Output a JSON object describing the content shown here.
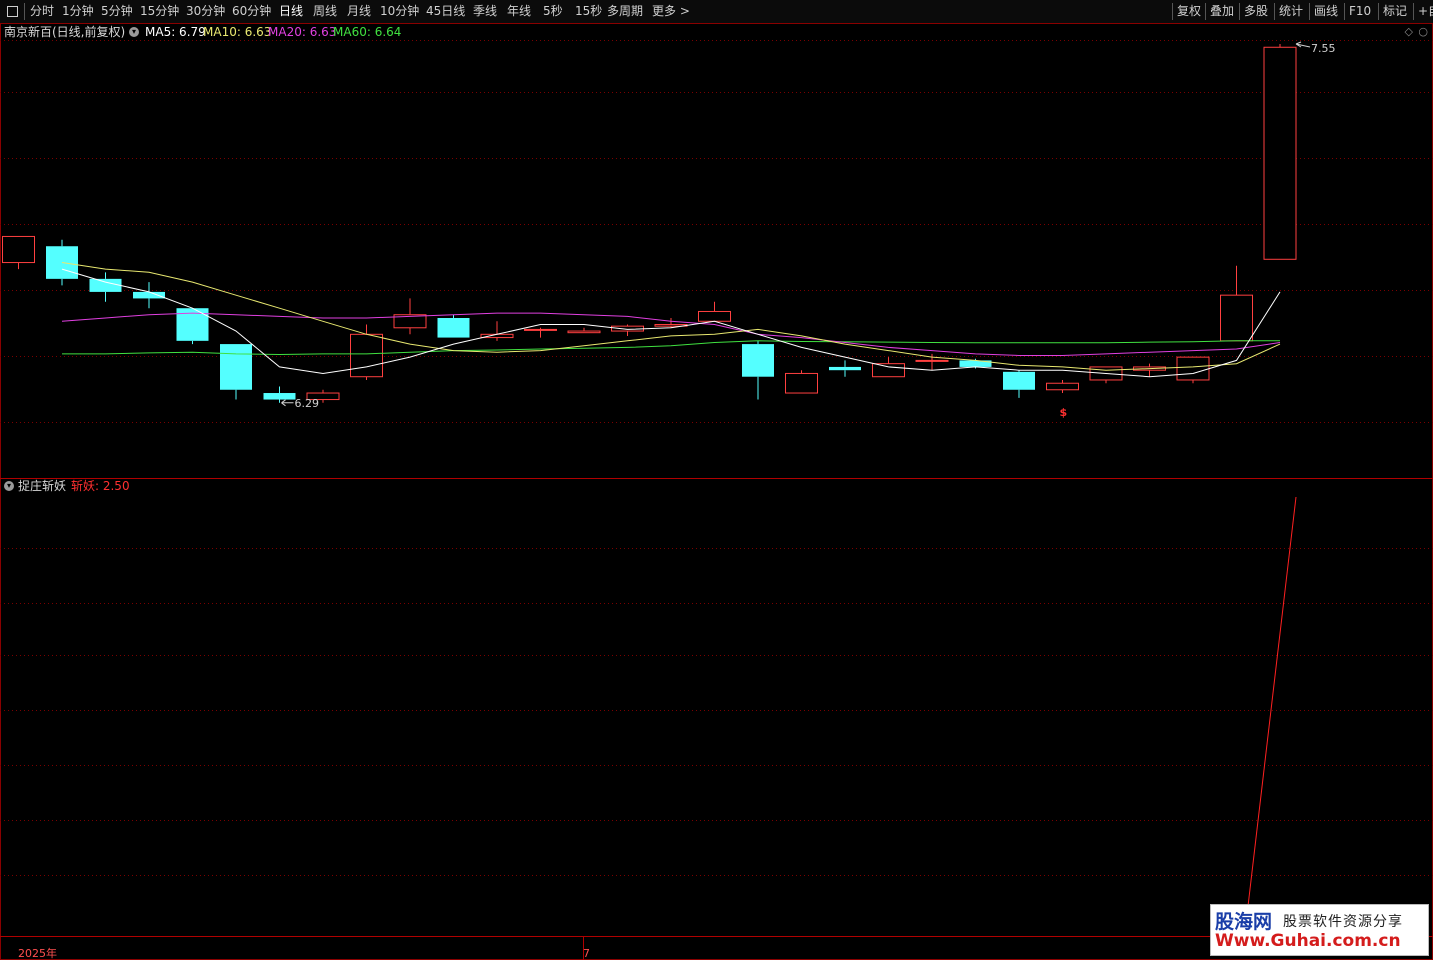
{
  "toolbar": {
    "periods": [
      "分时",
      "1分钟",
      "5分钟",
      "15分钟",
      "30分钟",
      "60分钟",
      "日线",
      "周线",
      "月线",
      "10分钟",
      "45日线",
      "季线",
      "年线",
      "5秒",
      "15秒",
      "多周期",
      "更多 >"
    ],
    "active_period": "日线",
    "right_buttons": [
      "复权",
      "叠加",
      "多股",
      "统计",
      "画线",
      "F10",
      "标记",
      "+自"
    ]
  },
  "main_chart": {
    "title": "南京新百(日线,前复权)",
    "ma": [
      {
        "label": "MA5: 6.79",
        "color": "#ffffff"
      },
      {
        "label": "MA10: 6.63",
        "color": "#e8e870"
      },
      {
        "label": "MA20: 6.63",
        "color": "#e040e0"
      },
      {
        "label": "MA60: 6.64",
        "color": "#40e040"
      }
    ],
    "high_label": "7.55",
    "low_label": "6.29",
    "signal_mark": "$"
  },
  "sub_chart": {
    "title": "捉庄斩妖",
    "value_label": "斩妖: 2.50"
  },
  "time_axis": {
    "year_label": "2025年",
    "month_label": "7"
  },
  "watermark": {
    "name": "股海网",
    "tagline": "股票软件资源分享",
    "url": "Www.Guhai.com.cn"
  },
  "colors": {
    "up": "#ff4040",
    "down": "#54ffff",
    "ma5": "#ffffff",
    "ma10": "#e8e870",
    "ma20": "#e040e0",
    "ma60": "#40e040",
    "grid": "#7a0000",
    "indicator": "#ff2020"
  },
  "chart_data": {
    "type": "candlestick",
    "price_range": [
      6.29,
      7.55
    ],
    "candles": [
      {
        "o": 6.88,
        "c": 6.96,
        "h": 6.96,
        "l": 6.86
      },
      {
        "o": 6.93,
        "c": 6.83,
        "h": 6.95,
        "l": 6.81
      },
      {
        "o": 6.83,
        "c": 6.79,
        "h": 6.85,
        "l": 6.76
      },
      {
        "o": 6.79,
        "c": 6.77,
        "h": 6.82,
        "l": 6.74
      },
      {
        "o": 6.74,
        "c": 6.64,
        "h": 6.74,
        "l": 6.63
      },
      {
        "o": 6.63,
        "c": 6.49,
        "h": 6.63,
        "l": 6.46
      },
      {
        "o": 6.48,
        "c": 6.46,
        "h": 6.5,
        "l": 6.45
      },
      {
        "o": 6.46,
        "c": 6.48,
        "h": 6.49,
        "l": 6.45
      },
      {
        "o": 6.53,
        "c": 6.66,
        "h": 6.69,
        "l": 6.52
      },
      {
        "o": 6.68,
        "c": 6.72,
        "h": 6.77,
        "l": 6.66
      },
      {
        "o": 6.71,
        "c": 6.65,
        "h": 6.72,
        "l": 6.65
      },
      {
        "o": 6.65,
        "c": 6.66,
        "h": 6.7,
        "l": 6.64
      },
      {
        "o": 6.675,
        "c": 6.675,
        "h": 6.68,
        "l": 6.65
      },
      {
        "o": 6.665,
        "c": 6.67,
        "h": 6.68,
        "l": 6.665
      },
      {
        "o": 6.67,
        "c": 6.685,
        "h": 6.69,
        "l": 6.655
      },
      {
        "o": 6.685,
        "c": 6.69,
        "h": 6.71,
        "l": 6.68
      },
      {
        "o": 6.7,
        "c": 6.73,
        "h": 6.76,
        "l": 6.7
      },
      {
        "o": 6.63,
        "c": 6.53,
        "h": 6.64,
        "l": 6.46
      },
      {
        "o": 6.48,
        "c": 6.54,
        "h": 6.55,
        "l": 6.48
      },
      {
        "o": 6.56,
        "c": 6.55,
        "h": 6.58,
        "l": 6.53
      },
      {
        "o": 6.53,
        "c": 6.57,
        "h": 6.59,
        "l": 6.53
      },
      {
        "o": 6.58,
        "c": 6.58,
        "h": 6.6,
        "l": 6.55
      },
      {
        "o": 6.58,
        "c": 6.56,
        "h": 6.585,
        "l": 6.555
      },
      {
        "o": 6.545,
        "c": 6.49,
        "h": 6.55,
        "l": 6.465
      },
      {
        "o": 6.49,
        "c": 6.51,
        "h": 6.52,
        "l": 6.48
      },
      {
        "o": 6.52,
        "c": 6.56,
        "h": 6.56,
        "l": 6.51
      },
      {
        "o": 6.55,
        "c": 6.56,
        "h": 6.57,
        "l": 6.53
      },
      {
        "o": 6.52,
        "c": 6.59,
        "h": 6.59,
        "l": 6.51
      },
      {
        "o": 6.64,
        "c": 6.78,
        "h": 6.87,
        "l": 6.64
      },
      {
        "o": 6.89,
        "c": 7.54,
        "h": 7.55,
        "l": 6.89
      }
    ],
    "ma5": [
      null,
      6.86,
      6.82,
      6.79,
      6.74,
      6.67,
      6.56,
      6.54,
      6.56,
      6.59,
      6.63,
      6.66,
      6.69,
      6.69,
      6.675,
      6.68,
      6.7,
      6.66,
      6.62,
      6.59,
      6.56,
      6.55,
      6.56,
      6.55,
      6.55,
      6.54,
      6.53,
      6.54,
      6.58,
      6.79
    ],
    "ma10": [
      null,
      6.88,
      6.86,
      6.85,
      6.82,
      6.78,
      6.74,
      6.7,
      6.66,
      6.63,
      6.61,
      6.605,
      6.61,
      6.625,
      6.64,
      6.655,
      6.66,
      6.675,
      6.655,
      6.63,
      6.61,
      6.59,
      6.58,
      6.565,
      6.56,
      6.55,
      6.555,
      6.56,
      6.57,
      6.63
    ],
    "ma20": [
      null,
      6.7,
      6.71,
      6.72,
      6.725,
      6.72,
      6.715,
      6.71,
      6.71,
      6.715,
      6.72,
      6.725,
      6.725,
      6.72,
      6.715,
      6.7,
      6.69,
      6.66,
      6.65,
      6.635,
      6.62,
      6.61,
      6.6,
      6.595,
      6.595,
      6.6,
      6.605,
      6.61,
      6.615,
      6.635
    ],
    "ma60": [
      null,
      6.6,
      6.6,
      6.603,
      6.605,
      6.6,
      6.598,
      6.6,
      6.6,
      6.605,
      6.61,
      6.612,
      6.615,
      6.617,
      6.62,
      6.625,
      6.635,
      6.64,
      6.638,
      6.637,
      6.636,
      6.635,
      6.634,
      6.634,
      6.634,
      6.634,
      6.636,
      6.637,
      6.64,
      6.64
    ],
    "indicator": {
      "name": "斩妖",
      "values": [
        0,
        0,
        0,
        0,
        0,
        0,
        0,
        0,
        0,
        0,
        0,
        0,
        0,
        0,
        0,
        0,
        0,
        0,
        0,
        0,
        0,
        0,
        0,
        0,
        0,
        0,
        0,
        0,
        0,
        2.5
      ],
      "range": [
        0,
        2.5
      ]
    }
  }
}
